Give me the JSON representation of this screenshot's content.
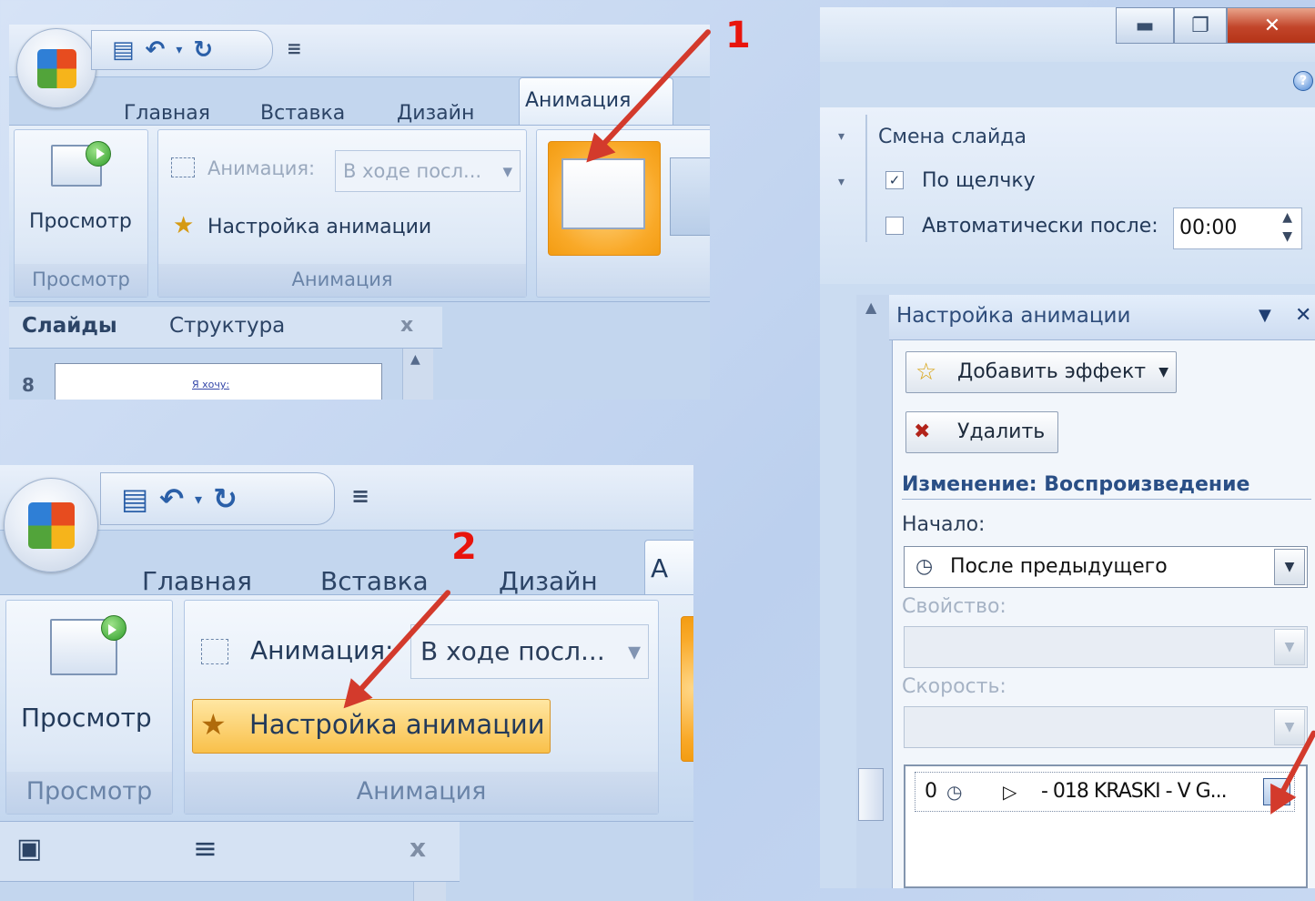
{
  "panel1": {
    "number": "1",
    "quick_access": {
      "save_icon": "save-icon",
      "undo_icon": "undo-icon",
      "redo_icon": "redo-icon",
      "more": "≡"
    },
    "tabs": [
      "Главная",
      "Вставка",
      "Дизайн",
      "Анимация"
    ],
    "preview_button": "Просмотр",
    "preview_group": "Просмотр",
    "animation_label": "Анимация:",
    "animation_value": "В ходе посл...",
    "custom_animation": "Настройка анимации",
    "animation_group": "Анимация",
    "pane_tabs": [
      "Слайды",
      "Структура"
    ],
    "close": "x",
    "slide_number": "8",
    "slide_text": "Я хочу:"
  },
  "panel2": {
    "number": "2",
    "tabs": [
      "Главная",
      "Вставка",
      "Дизайн",
      "А"
    ],
    "preview_button": "Просмотр",
    "preview_group": "Просмотр",
    "animation_label": "Анимация:",
    "animation_value": "В ходе посл...",
    "custom_animation": "Настройка анимации",
    "animation_group": "Анимация",
    "close": "x"
  },
  "panel3": {
    "slide_change": {
      "title": "Смена слайда",
      "on_click": "По щелчку",
      "on_click_checked": true,
      "auto_after": "Автоматически после:",
      "auto_after_checked": false,
      "auto_time": "00:00"
    },
    "task_pane": {
      "title": "Настройка анимации",
      "add_effect": "Добавить эффект",
      "remove": "Удалить",
      "section": "Изменение: Воспроизведение",
      "start_label": "Начало:",
      "start_value": "После предыдущего",
      "property_label": "Свойство:",
      "speed_label": "Скорость:",
      "list_item": {
        "order": "0",
        "name": "- 018 KRASKI - V G..."
      }
    },
    "close": "✕"
  }
}
